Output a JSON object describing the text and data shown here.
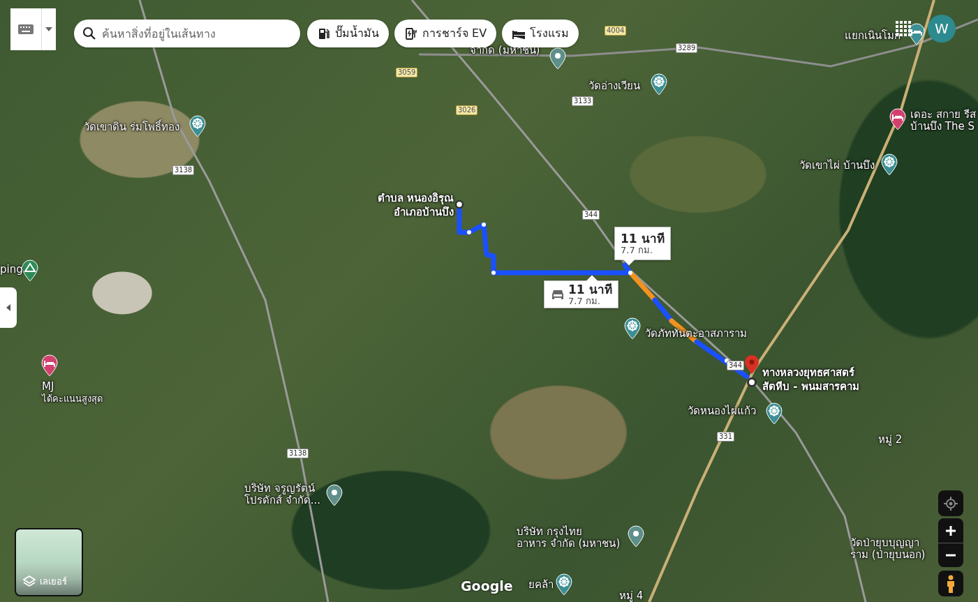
{
  "search": {
    "placeholder": "ค้นหาสิ่งที่อยู่ในเส้นทาง"
  },
  "chips": [
    {
      "label": "ปั๊มน้ำมัน",
      "kind": "fuel"
    },
    {
      "label": "การชาร์จ EV",
      "kind": "ev"
    },
    {
      "label": "โรงแรม",
      "kind": "hotel"
    }
  ],
  "account": {
    "initial": "W"
  },
  "places": [
    {
      "kind": "hotel-grey",
      "lines": [
        "แยกเนินโมก"
      ]
    },
    {
      "kind": "pin",
      "lines": [
        "จำกัด (มหาชน)"
      ]
    },
    {
      "kind": "temple",
      "lines": [
        "วัดอ่างเวียน"
      ]
    },
    {
      "kind": "temple",
      "lines": [
        "วัดเขาดิน ร่มโพธิ์ทอง"
      ]
    },
    {
      "kind": "hotel",
      "lines": [
        "เดอะ สกาย รีส",
        "บ้านบึง The S"
      ]
    },
    {
      "kind": "temple",
      "lines": [
        "วัดเขาไผ่ บ้านบึง"
      ]
    },
    {
      "kind": "camp",
      "lines": [
        "ping"
      ]
    },
    {
      "kind": "temple",
      "lines": [
        "วัดภัททันตะอาสภาราม"
      ]
    },
    {
      "kind": "hotel",
      "lines": [
        "MJ",
        "ได้คะแนนสูงสุด"
      ]
    },
    {
      "kind": "temple",
      "lines": [
        "วัดหนองไผ่แก้ว"
      ]
    },
    {
      "kind": "none",
      "lines": [
        "หมู่ 2"
      ]
    },
    {
      "kind": "pin",
      "lines": [
        "บริษัท จรูญรัตน์",
        "โปรดักส์ จำกัด..."
      ]
    },
    {
      "kind": "pin",
      "lines": [
        "บริษัท กรุงไทย",
        "อาหาร จำกัด (มหาชน)"
      ]
    },
    {
      "kind": "none",
      "lines": [
        "วัดป่ายุบบุญญา",
        "ราม (ป่ายุบนอก)"
      ]
    },
    {
      "kind": "temple",
      "lines": [
        "ยคล้า"
      ]
    },
    {
      "kind": "none",
      "lines": [
        "หมู่ 4"
      ]
    }
  ],
  "road_shields": [
    {
      "label": "4004",
      "kind": "yellow"
    },
    {
      "label": "3289",
      "kind": "white"
    },
    {
      "label": "3059",
      "kind": "yellow"
    },
    {
      "label": "3026",
      "kind": "yellow"
    },
    {
      "label": "3138",
      "kind": "white"
    },
    {
      "label": "3133",
      "kind": "white"
    },
    {
      "label": "344",
      "kind": "white"
    },
    {
      "label": "344",
      "kind": "white"
    },
    {
      "label": "331",
      "kind": "white"
    },
    {
      "label": "3138",
      "kind": "white"
    }
  ],
  "route": {
    "origin": [
      "ตำบล หนองอิรุณ",
      "อำเภอบ้านบึง"
    ],
    "destination": [
      "ทางหลวงยุทธศาสตร์",
      "สัตหีบ - พนมสารคาม"
    ],
    "callouts": [
      {
        "duration": "11 นาที",
        "distance": "7.7 กม.",
        "selected": true
      },
      {
        "duration": "11 นาที",
        "distance": "7.7 กม.",
        "selected": false
      }
    ]
  },
  "layers": {
    "label": "เลเยอร์"
  },
  "logo": {
    "text": "Google"
  }
}
